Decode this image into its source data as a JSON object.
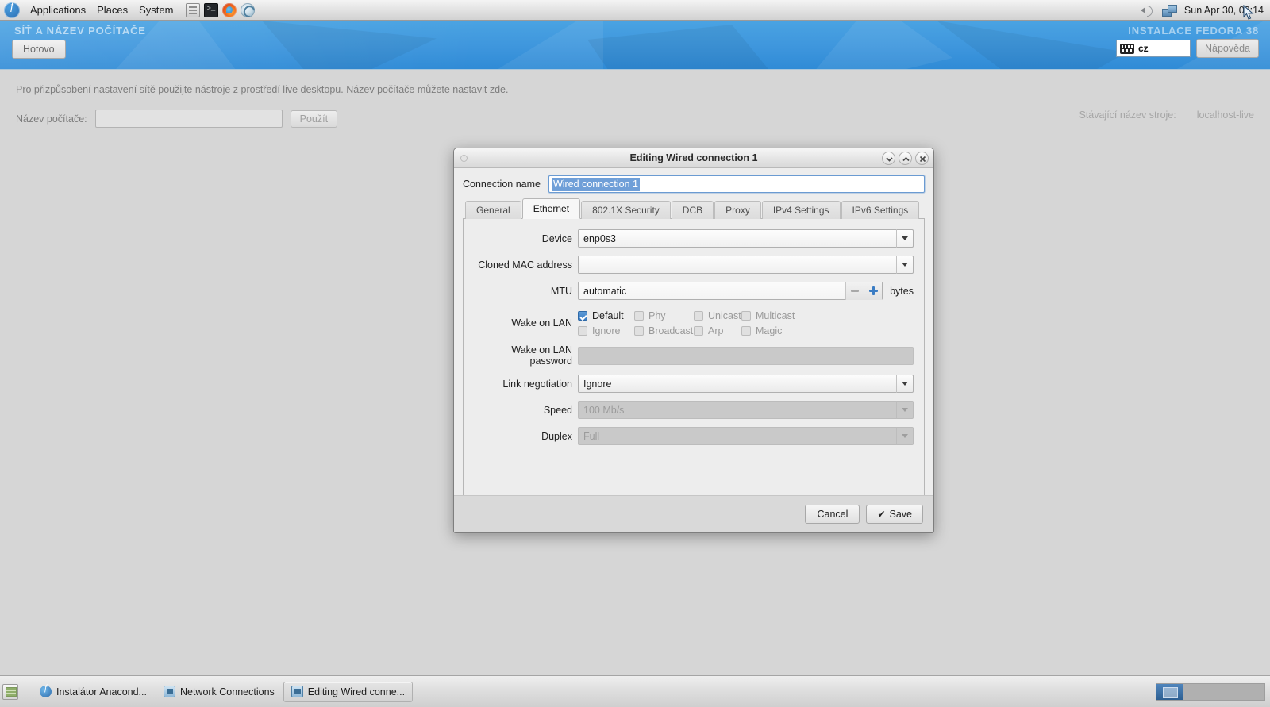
{
  "desktop_panel": {
    "logo_icon": "fedora-logo-icon",
    "menus": [
      {
        "label": "Applications"
      },
      {
        "label": "Places"
      },
      {
        "label": "System"
      }
    ],
    "launchers": [
      {
        "name": "file-manager-launcher",
        "icon": "files-icon"
      },
      {
        "name": "terminal-launcher",
        "icon": "terminal-icon"
      },
      {
        "name": "firefox-launcher",
        "icon": "firefox-icon"
      },
      {
        "name": "browser-launcher",
        "icon": "web-browser-icon"
      }
    ],
    "tray": {
      "volume_icon": "speaker-icon",
      "network_icon": "network-icon",
      "clock": "Sun Apr 30, 08:14"
    }
  },
  "installer": {
    "spoke_title": "SÍŤ A NÁZEV POČÍTAČE",
    "product_title": "INSTALACE FEDORA 38",
    "done_label": "Hotovo",
    "help_label": "Nápověda",
    "keyboard_layout": "cz",
    "keyboard_icon": "keyboard-icon",
    "hint": "Pro přizpůsobení nastavení sítě použijte nástroje z prostředí live desktopu. Název počítače můžete nastavit zde.",
    "hostname_label": "Název počítače:",
    "hostname_value": "",
    "hostname_placeholder": "",
    "apply_label": "Použít",
    "current_hostname_label": "Stávající název stroje:",
    "current_hostname_value": "localhost-live"
  },
  "dialog": {
    "title": "Editing Wired connection 1",
    "titlebar_buttons": [
      {
        "name": "minimize-button",
        "icon": "chevron-down-icon"
      },
      {
        "name": "maximize-button",
        "icon": "chevron-up-icon"
      },
      {
        "name": "close-button",
        "icon": "close-icon"
      }
    ],
    "connection_name_label": "Connection name",
    "connection_name_value": "Wired connection 1",
    "tabs": [
      {
        "label": "General",
        "active": false
      },
      {
        "label": "Ethernet",
        "active": true
      },
      {
        "label": "802.1X Security",
        "active": false
      },
      {
        "label": "DCB",
        "active": false
      },
      {
        "label": "Proxy",
        "active": false
      },
      {
        "label": "IPv4 Settings",
        "active": false
      },
      {
        "label": "IPv6 Settings",
        "active": false
      }
    ],
    "ethernet": {
      "device_label": "Device",
      "device_value": "enp0s3",
      "cloned_mac_label": "Cloned MAC address",
      "cloned_mac_value": "",
      "mtu_label": "MTU",
      "mtu_value": "automatic",
      "mtu_units": "bytes",
      "mtu_minus_icon": "minus-icon",
      "mtu_plus_icon": "plus-icon",
      "wol_label": "Wake on LAN",
      "wol_options_row1": [
        {
          "label": "Default",
          "checked": true,
          "enabled": true
        },
        {
          "label": "Phy",
          "checked": false,
          "enabled": false
        },
        {
          "label": "Unicast",
          "checked": false,
          "enabled": false
        },
        {
          "label": "Multicast",
          "checked": false,
          "enabled": false
        }
      ],
      "wol_options_row2": [
        {
          "label": "Ignore",
          "checked": false,
          "enabled": false
        },
        {
          "label": "Broadcast",
          "checked": false,
          "enabled": false
        },
        {
          "label": "Arp",
          "checked": false,
          "enabled": false
        },
        {
          "label": "Magic",
          "checked": false,
          "enabled": false
        }
      ],
      "wol_password_label": "Wake on LAN password",
      "wol_password_value": "",
      "link_negotiation_label": "Link negotiation",
      "link_negotiation_value": "Ignore",
      "speed_label": "Speed",
      "speed_value": "100 Mb/s",
      "duplex_label": "Duplex",
      "duplex_value": "Full"
    },
    "cancel_label": "Cancel",
    "save_label": "Save",
    "save_icon": "check-icon"
  },
  "taskbar": {
    "show_desktop_icon": "show-desktop-icon",
    "tasks": [
      {
        "label": "Instalátor Anacond...",
        "icon": "anaconda-icon",
        "active": false
      },
      {
        "label": "Network Connections",
        "icon": "nm-connection-editor-icon",
        "active": false
      },
      {
        "label": "Editing Wired conne...",
        "icon": "nm-connection-editor-icon",
        "active": true
      }
    ],
    "workspaces": [
      {
        "name": "workspace-1",
        "active": true
      },
      {
        "name": "workspace-2",
        "active": false
      },
      {
        "name": "workspace-3",
        "active": false
      },
      {
        "name": "workspace-4",
        "active": false
      }
    ]
  },
  "colors": {
    "accent_blue": "#3b7dc4",
    "selection_blue": "#6f9fd8",
    "banner_blue": "#3e96dd",
    "panel_gray": "#ededed"
  }
}
